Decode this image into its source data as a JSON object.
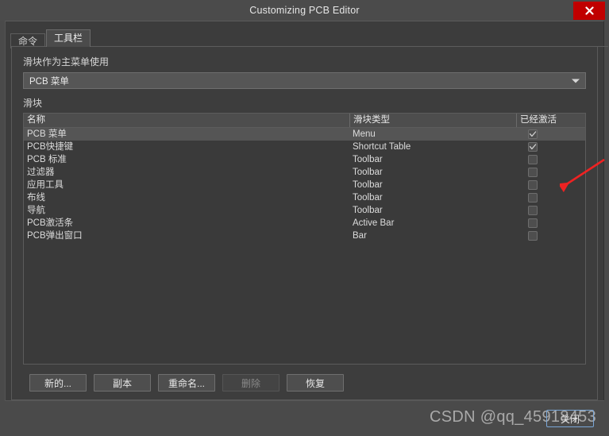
{
  "window": {
    "title": "Customizing PCB Editor",
    "close_icon": "close-icon",
    "close_label": "✕"
  },
  "tabs": [
    {
      "label": "命令",
      "active": false
    },
    {
      "label": "工具栏",
      "active": true
    }
  ],
  "form": {
    "slider_as_main_menu_label": "滑块作为主菜单使用",
    "combo_value": "PCB 菜单",
    "combo_arrow_icon": "chevron-down-icon",
    "slider_section_label": "滑块"
  },
  "table": {
    "columns": [
      {
        "key": "name",
        "label": "名称"
      },
      {
        "key": "type",
        "label": "滑块类型"
      },
      {
        "key": "active",
        "label": "已经激活"
      }
    ],
    "rows": [
      {
        "name": "PCB 菜单",
        "type": "Menu",
        "active": true,
        "selected": true
      },
      {
        "name": "PCB快捷键",
        "type": "Shortcut Table",
        "active": true,
        "selected": false
      },
      {
        "name": "PCB 标准",
        "type": "Toolbar",
        "active": false,
        "selected": false
      },
      {
        "name": "过滤器",
        "type": "Toolbar",
        "active": false,
        "selected": false
      },
      {
        "name": "应用工具",
        "type": "Toolbar",
        "active": false,
        "selected": false
      },
      {
        "name": "布线",
        "type": "Toolbar",
        "active": false,
        "selected": false
      },
      {
        "name": "导航",
        "type": "Toolbar",
        "active": false,
        "selected": false
      },
      {
        "name": "PCB激活条",
        "type": "Active Bar",
        "active": false,
        "selected": false
      },
      {
        "name": "PCB弹出窗口",
        "type": "Bar",
        "active": false,
        "selected": false
      }
    ]
  },
  "buttons": [
    {
      "label": "新的...",
      "disabled": false
    },
    {
      "label": "副本",
      "disabled": false
    },
    {
      "label": "重命名...",
      "disabled": false
    },
    {
      "label": "删除",
      "disabled": true
    },
    {
      "label": "恢复",
      "disabled": false
    }
  ],
  "footer": {
    "watermark": "CSDN @qq_45918453",
    "close_button_label": "关闭"
  },
  "annotation": {
    "arrow_color": "#ee2222",
    "arrow_icon": "arrow-pointer-icon"
  },
  "colors": {
    "window_bg": "#4a4a4a",
    "panel_bg": "#3d3d3d",
    "accent_close": "#c00000",
    "focus_outline": "#7ba7d7",
    "text": "#e6e6e6"
  }
}
